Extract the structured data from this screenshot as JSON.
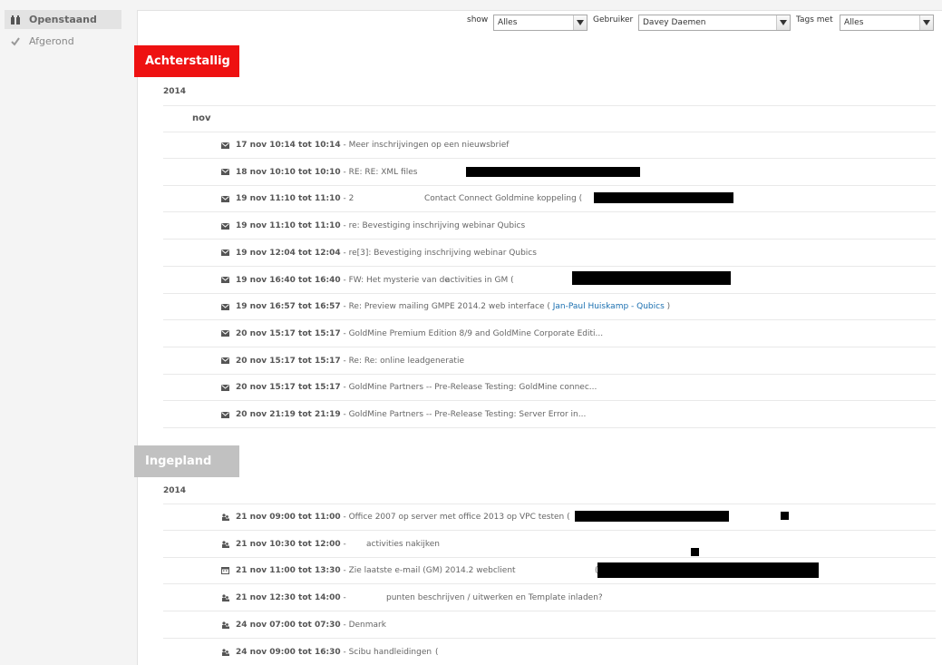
{
  "sidebar": {
    "items": [
      {
        "label": "Openstaand",
        "icon": "tasks-icon",
        "active": true
      },
      {
        "label": "Afgerond",
        "icon": "checkmark-icon",
        "active": false
      }
    ]
  },
  "filters": {
    "show_label": "show",
    "show_value": "Alles",
    "user_label": "Gebruiker",
    "user_value": "Davey Daemen",
    "tags_label": "Tags met",
    "tags_value": "Alles"
  },
  "sections": [
    {
      "title": "Achterstallig",
      "color": "#ee1111",
      "year": "2014",
      "month": "nov",
      "items": [
        {
          "icon": "envelope-icon",
          "time": "17 nov 10:14 tot 10:14",
          "text": " - Meer inschrijvingen op een nieuwsbrief",
          "extra": ""
        },
        {
          "icon": "envelope-icon",
          "time": "18 nov 10:10 tot 10:10",
          "text": " - RE: RE: XML files",
          "extra": "("
        },
        {
          "icon": "envelope-icon",
          "time": "19 nov 11:10 tot 11:10",
          "text": " - 2",
          "extra": "Contact Connect Goldmine koppeling  ("
        },
        {
          "icon": "envelope-icon",
          "time": "19 nov 11:10 tot 11:10",
          "text": " - re: Bevestiging inschrijving webinar Qubics",
          "extra": ""
        },
        {
          "icon": "envelope-icon",
          "time": "19 nov 12:04 tot 12:04",
          "text": " - re[3]: Bevestiging inschrijving webinar Qubics",
          "extra": ""
        },
        {
          "icon": "envelope-icon",
          "time": "19 nov 16:40 tot 16:40",
          "text": " - FW: Het mysterie van de",
          "extra": "activities in GM  ("
        },
        {
          "icon": "envelope-icon",
          "time": "19 nov 16:57 tot 16:57",
          "text": " - Re: Preview mailing GMPE 2014.2 web interface  (",
          "link": "Jan-Paul Huiskamp - Qubics",
          "close": " )"
        },
        {
          "icon": "envelope-icon",
          "time": "20 nov 15:17 tot 15:17",
          "text": " - GoldMine Premium Edition 8/9 and GoldMine Corporate Editi...",
          "extra": ""
        },
        {
          "icon": "envelope-icon",
          "time": "20 nov 15:17 tot 15:17",
          "text": " - Re: Re: online leadgeneratie",
          "extra": ""
        },
        {
          "icon": "envelope-icon",
          "time": "20 nov 15:17 tot 15:17",
          "text": " - GoldMine Partners -- Pre-Release Testing: GoldMine connec...",
          "extra": ""
        },
        {
          "icon": "envelope-icon",
          "time": "20 nov 21:19 tot 21:19",
          "text": " - GoldMine Partners -- Pre-Release Testing: Server Error in...",
          "extra": ""
        }
      ]
    },
    {
      "title": "Ingepland",
      "color": "#c1c1c1",
      "year": "2014",
      "items": [
        {
          "icon": "people-icon",
          "time": "21 nov 09:00 tot 11:00",
          "text": " - Office 2007 op server met office 2013 op VPC testen  (",
          "extra": ""
        },
        {
          "icon": "people-icon",
          "time": "21 nov 10:30 tot 12:00",
          "text": " -",
          "extra": "activities nakijken"
        },
        {
          "icon": "calendar-icon",
          "time": "21 nov 11:00 tot 13:30",
          "text": " - Zie laatste e-mail (GM) 2014.2 webclient",
          "extra": "("
        },
        {
          "icon": "people-icon",
          "time": "21 nov 12:30 tot 14:00",
          "text": " -",
          "extra": "punten beschrijven / uitwerken en Template inladen?"
        },
        {
          "icon": "people-icon",
          "time": "24 nov 07:00 tot 07:30",
          "text": " - Denmark",
          "extra": ""
        },
        {
          "icon": "people-icon",
          "time": "24 nov 09:00 tot 16:30",
          "text": " - Scibu handleidingen",
          "extra": "("
        }
      ]
    }
  ]
}
